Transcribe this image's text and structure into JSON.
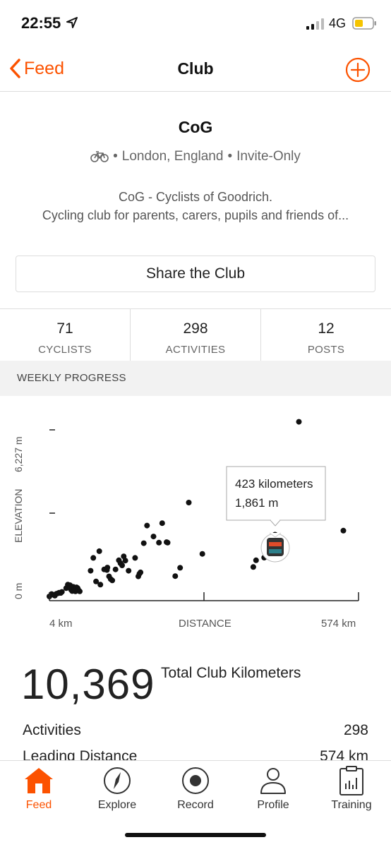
{
  "status_bar": {
    "time": "22:55",
    "network": "4G"
  },
  "nav": {
    "back_label": "Feed",
    "title": "Club"
  },
  "club": {
    "name": "CoG",
    "location": "London, England",
    "privacy": "Invite-Only",
    "separator": "•",
    "description_line1": "CoG - Cyclists of Goodrich.",
    "description_line2": "Cycling club for parents, carers, pupils and friends of..."
  },
  "share_button_label": "Share the Club",
  "stats": [
    {
      "value": "71",
      "label": "CYCLISTS"
    },
    {
      "value": "298",
      "label": "ACTIVITIES"
    },
    {
      "value": "12",
      "label": "POSTS"
    }
  ],
  "section_header": "WEEKLY PROGRESS",
  "chart_data": {
    "type": "scatter",
    "xlabel": "DISTANCE",
    "ylabel": "ELEVATION",
    "x_tick_labels": [
      "4 km",
      "574 km"
    ],
    "y_tick_labels": [
      "0 m",
      "6,227 m"
    ],
    "xlim": [
      4,
      574
    ],
    "ylim": [
      0,
      6227
    ],
    "points": [
      [
        4,
        0
      ],
      [
        8,
        90
      ],
      [
        12,
        60
      ],
      [
        14,
        30
      ],
      [
        17,
        100
      ],
      [
        20,
        120
      ],
      [
        22,
        140
      ],
      [
        25,
        130
      ],
      [
        27,
        170
      ],
      [
        35,
        310
      ],
      [
        38,
        440
      ],
      [
        42,
        420
      ],
      [
        44,
        250
      ],
      [
        46,
        200
      ],
      [
        48,
        360
      ],
      [
        50,
        280
      ],
      [
        52,
        190
      ],
      [
        54,
        340
      ],
      [
        56,
        310
      ],
      [
        58,
        230
      ],
      [
        60,
        190
      ],
      [
        80,
        960
      ],
      [
        85,
        1440
      ],
      [
        90,
        560
      ],
      [
        96,
        1690
      ],
      [
        98,
        440
      ],
      [
        105,
        1010
      ],
      [
        110,
        990
      ],
      [
        111,
        1080
      ],
      [
        114,
        750
      ],
      [
        117,
        650
      ],
      [
        120,
        600
      ],
      [
        126,
        1010
      ],
      [
        132,
        1350
      ],
      [
        135,
        1240
      ],
      [
        138,
        1160
      ],
      [
        141,
        1500
      ],
      [
        144,
        1340
      ],
      [
        150,
        960
      ],
      [
        162,
        1440
      ],
      [
        168,
        750
      ],
      [
        170,
        850
      ],
      [
        172,
        900
      ],
      [
        178,
        1990
      ],
      [
        184,
        2650
      ],
      [
        196,
        2240
      ],
      [
        206,
        2010
      ],
      [
        212,
        2740
      ],
      [
        220,
        2030
      ],
      [
        222,
        2010
      ],
      [
        236,
        760
      ],
      [
        245,
        1070
      ],
      [
        261,
        3510
      ],
      [
        286,
        1590
      ],
      [
        380,
        1100
      ],
      [
        385,
        1350
      ],
      [
        400,
        1450
      ],
      [
        420,
        2310
      ],
      [
        444,
        4740
      ],
      [
        464,
        6527
      ],
      [
        546,
        2460
      ]
    ],
    "highlight": {
      "x": 423,
      "y": 1861
    },
    "tooltip": {
      "line1": "423 kilometers",
      "line2": "1,861 m"
    }
  },
  "totals": {
    "total_km": "10,369",
    "total_label": "Total Club Kilometers",
    "activities_label": "Activities",
    "activities_value": "298",
    "leading_label": "Leading Distance",
    "leading_value": "574 km"
  },
  "tabs": [
    {
      "label": "Feed",
      "icon": "home-icon",
      "active": true
    },
    {
      "label": "Explore",
      "icon": "compass-icon",
      "active": false
    },
    {
      "label": "Record",
      "icon": "record-icon",
      "active": false
    },
    {
      "label": "Profile",
      "icon": "person-icon",
      "active": false
    },
    {
      "label": "Training",
      "icon": "clipboard-chart-icon",
      "active": false
    }
  ],
  "colors": {
    "accent": "#fc5200",
    "text": "#222222",
    "muted": "#666666"
  }
}
